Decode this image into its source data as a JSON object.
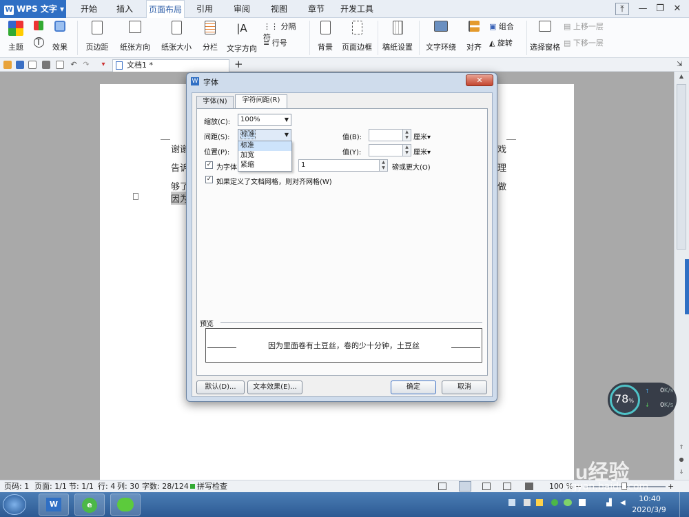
{
  "app": {
    "name": "WPS 文字",
    "logo": "W"
  },
  "menu_tabs": [
    "开始",
    "插入",
    "页面布局",
    "引用",
    "审阅",
    "视图",
    "章节",
    "开发工具"
  ],
  "active_menu_tab": "页面布局",
  "ribbon": {
    "theme": "主题",
    "effects": "效果",
    "margins": "页边距",
    "orientation": "纸张方向",
    "size": "纸张大小",
    "columns": "分栏",
    "text_direction": "文字方向",
    "breaks": "分隔符",
    "line_numbers": "行号",
    "background": "背景",
    "page_borders": "页面边框",
    "manuscript": "稿纸设置",
    "text_wrap": "文字环绕",
    "align": "对齐",
    "group": "组合",
    "rotate": "旋转",
    "selection_pane": "选择窗格",
    "bring_forward": "上移一层",
    "send_backward": "下移一层"
  },
  "document_tab": "文档1 *",
  "document_text": [
    "谢谢",
    "告诉",
    "够了",
    "因为"
  ],
  "document_text_right": [
    "戏",
    "理",
    "做"
  ],
  "dialog": {
    "title": "字体",
    "tabs": [
      "字体(N)",
      "字符间距(R)"
    ],
    "active_tab": "字符间距(R)",
    "scale_label": "缩放(C):",
    "scale_value": "100%",
    "spacing_label": "间距(S):",
    "spacing_value": "标准",
    "spacing_options": [
      "标准",
      "加宽",
      "紧缩"
    ],
    "position_label": "位置(P):",
    "value_b_label": "值(B):",
    "value_y_label": "值(Y):",
    "unit": "厘米",
    "kerning_label": "为字体",
    "kerning_value": "1",
    "kerning_suffix": "磅或更大(O)",
    "kerning_checked": true,
    "grid_label": "如果定义了文档网格，则对齐网格(W)",
    "grid_checked": true,
    "preview_label": "预览",
    "preview_text": "因为里面卷有土豆丝，卷的少十分钟，土豆丝",
    "buttons": {
      "default": "默认(D)...",
      "text_effects": "文本效果(E)...",
      "ok": "确定",
      "cancel": "取消"
    }
  },
  "statusbar": {
    "page": "页码: 1",
    "pages": "页面: 1/1",
    "section": "节: 1/1",
    "row": "行: 4",
    "col": "列: 30",
    "words": "字数: 28/124",
    "spell": "拼写检查",
    "zoom": "100 %"
  },
  "perf_widget": {
    "percent": "78",
    "unit": "%",
    "up": "0",
    "down": "0",
    "rate_unit": "K/s"
  },
  "taskbar": {
    "time": "10:40",
    "date": "2020/3/9"
  },
  "watermark": {
    "brand": "Baidu经验",
    "url": "jingyan.baidu.com"
  }
}
